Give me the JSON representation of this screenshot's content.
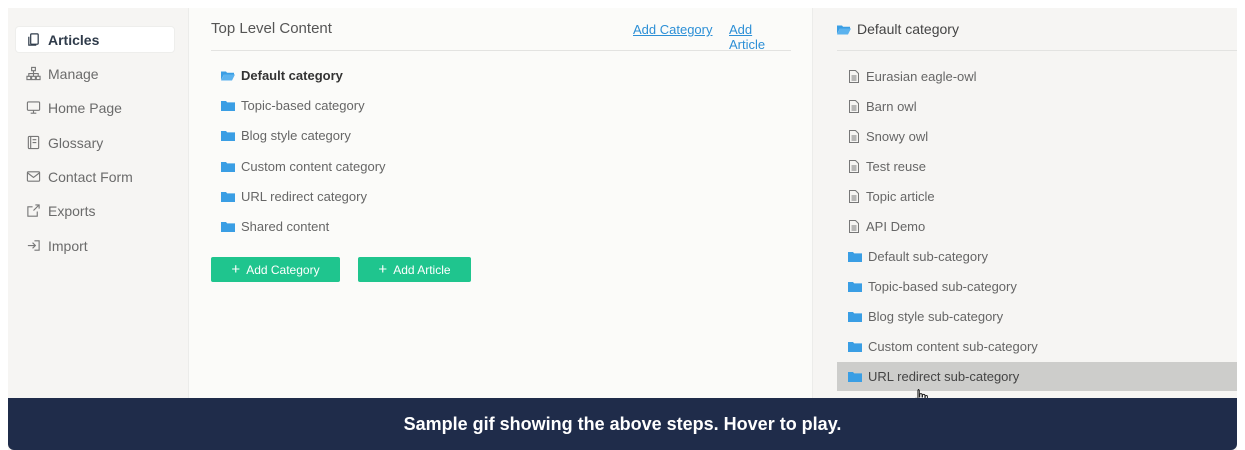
{
  "colors": {
    "accent_green": "#1fc58e",
    "link_blue": "#2c8fd6",
    "folder_blue": "#3a9ee4",
    "caption_bg": "#1f2c4a",
    "hover_row": "#cdcdcb"
  },
  "sidebar": {
    "items": [
      {
        "label": "Articles",
        "icon": "copy-icon",
        "active": true
      },
      {
        "label": "Manage",
        "icon": "sitemap-icon"
      },
      {
        "label": "Home Page",
        "icon": "monitor-icon"
      },
      {
        "label": "Glossary",
        "icon": "book-icon"
      },
      {
        "label": "Contact Form",
        "icon": "envelope-icon"
      },
      {
        "label": "Exports",
        "icon": "export-icon"
      },
      {
        "label": "Import",
        "icon": "import-icon"
      }
    ]
  },
  "center": {
    "title": "Top Level Content",
    "add_category_link": "Add Category",
    "add_article_link": "Add Article",
    "categories": [
      {
        "label": "Default category",
        "icon": "folder-open-icon",
        "selected": true
      },
      {
        "label": "Topic-based category",
        "icon": "folder-icon"
      },
      {
        "label": "Blog style category",
        "icon": "folder-icon"
      },
      {
        "label": "Custom content category",
        "icon": "folder-icon"
      },
      {
        "label": "URL redirect category",
        "icon": "folder-icon"
      },
      {
        "label": "Shared content",
        "icon": "folder-icon"
      }
    ],
    "add_category_button": "Add Category",
    "add_article_button": "Add Article"
  },
  "right": {
    "title": "Default category",
    "items": [
      {
        "label": "Eurasian eagle-owl",
        "type": "article",
        "icon": "document-icon"
      },
      {
        "label": "Barn owl",
        "type": "article",
        "icon": "document-icon"
      },
      {
        "label": "Snowy owl",
        "type": "article",
        "icon": "document-icon"
      },
      {
        "label": "Test reuse",
        "type": "article",
        "icon": "document-icon"
      },
      {
        "label": "Topic article",
        "type": "article",
        "icon": "document-icon"
      },
      {
        "label": "API Demo",
        "type": "article",
        "icon": "document-icon"
      },
      {
        "label": "Default sub-category",
        "type": "folder",
        "icon": "folder-icon"
      },
      {
        "label": "Topic-based sub-category",
        "type": "folder",
        "icon": "folder-icon"
      },
      {
        "label": "Blog style sub-category",
        "type": "folder",
        "icon": "folder-icon"
      },
      {
        "label": "Custom content sub-category",
        "type": "folder",
        "icon": "folder-icon"
      },
      {
        "label": "URL redirect sub-category",
        "type": "folder",
        "icon": "folder-icon",
        "hovered": true
      }
    ]
  },
  "caption": "Sample gif showing the above steps. Hover to play."
}
